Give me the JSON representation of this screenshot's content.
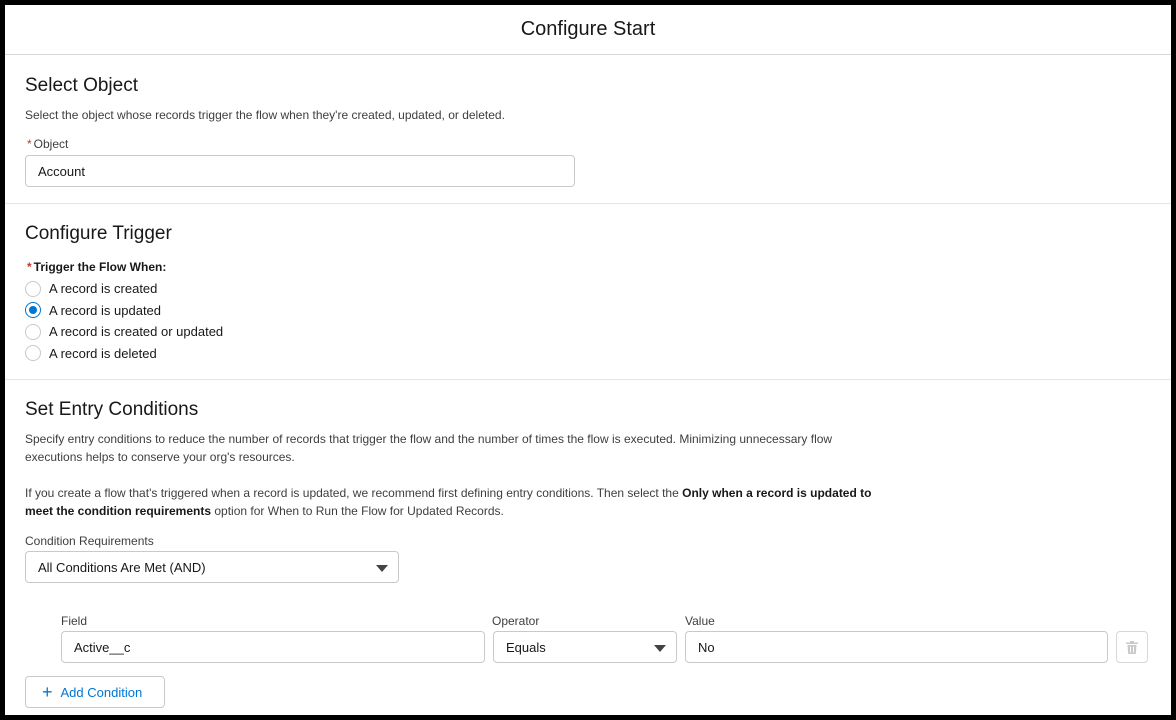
{
  "header": {
    "title": "Configure Start"
  },
  "select_object": {
    "title": "Select Object",
    "description": "Select the object whose records trigger the flow when they're created, updated, or deleted.",
    "object_label": "Object",
    "object_value": "Account",
    "required_mark": "*"
  },
  "configure_trigger": {
    "title": "Configure Trigger",
    "trigger_label": "Trigger the Flow When:",
    "required_mark": "*",
    "options": [
      {
        "label": "A record is created",
        "selected": false
      },
      {
        "label": "A record is updated",
        "selected": true
      },
      {
        "label": "A record is created or updated",
        "selected": false
      },
      {
        "label": "A record is deleted",
        "selected": false
      }
    ]
  },
  "entry_conditions": {
    "title": "Set Entry Conditions",
    "description": "Specify entry conditions to reduce the number of records that trigger the flow and the number of times the flow is executed. Minimizing unnecessary flow executions helps to conserve your org's resources.",
    "recommendation_prefix": "If you create a flow that's triggered when a record is updated, we recommend first defining entry conditions. Then select the",
    "recommendation_bold": "Only when a record is updated to meet the condition requirements",
    "recommendation_suffix": "option for When to Run the Flow for Updated Records.",
    "requirements_label": "Condition Requirements",
    "requirements_value": "All Conditions Are Met (AND)",
    "condition": {
      "field_label": "Field",
      "field_value": "Active__c",
      "operator_label": "Operator",
      "operator_value": "Equals",
      "value_label": "Value",
      "value_value": "No"
    },
    "add_condition_label": "Add Condition"
  },
  "icons": {
    "delete": "trash-icon",
    "add": "plus-icon",
    "dropdown": "chevron-down-icon"
  },
  "colors": {
    "accent": "#0176d3",
    "required": "#c23934"
  }
}
